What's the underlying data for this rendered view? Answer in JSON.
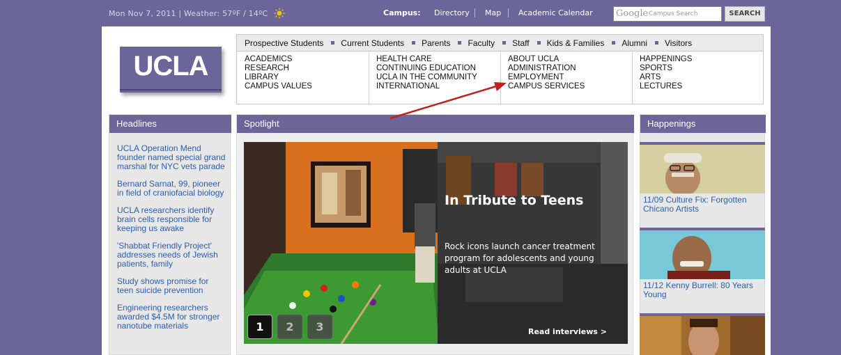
{
  "topbar": {
    "date_weather": "Mon Nov 7, 2011 | Weather: 57ºF / 14ºC",
    "campus_label": "Campus:",
    "links": [
      "Directory",
      "Map",
      "Academic Calendar"
    ],
    "search_logo": "Google",
    "search_placeholder": "Campus Search",
    "search_button": "SEARCH"
  },
  "logo": {
    "text": "UCLA"
  },
  "audience": [
    "Prospective Students",
    "Current Students",
    "Parents",
    "Faculty",
    "Staff",
    "Kids & Families",
    "Alumni",
    "Visitors"
  ],
  "mega_menu": [
    [
      "ACADEMICS",
      "RESEARCH",
      "LIBRARY",
      "CAMPUS VALUES"
    ],
    [
      "HEALTH CARE",
      "CONTINUING EDUCATION",
      "UCLA IN THE COMMUNITY",
      "INTERNATIONAL"
    ],
    [
      "ABOUT UCLA",
      "ADMINISTRATION",
      "EMPLOYMENT",
      "CAMPUS SERVICES"
    ],
    [
      "HAPPENINGS",
      "SPORTS",
      "ARTS",
      "LECTURES"
    ]
  ],
  "headlines": {
    "title": "Headlines",
    "items": [
      "UCLA Operation Mend founder named special grand marshal for NYC vets parade",
      "Bernard Sarnat, 99, pioneer in field of craniofacial biology",
      "UCLA researchers identify brain cells responsible for keeping us awake",
      "'Shabbat Friendly Project' addresses needs of Jewish patients, family",
      "Study shows promise for teen suicide prevention",
      "Engineering researchers awarded $4.5M for stronger nanotube materials"
    ]
  },
  "spotlight": {
    "title": "Spotlight",
    "slide_title": "In Tribute to Teens",
    "slide_description": "Rock icons launch cancer treatment program for adolescents and young adults at UCLA",
    "read_more": "Read interviews  >",
    "pager": [
      "1",
      "2",
      "3"
    ],
    "active_page": "1"
  },
  "happenings": {
    "title": "Happenings",
    "items": [
      "11/09 Culture Fix: Forgotten Chicano Artists",
      "11/12 Kenny Burrell: 80 Years Young"
    ]
  },
  "colors": {
    "brand_purple": "#6b6599",
    "link_blue": "#2a5db0",
    "annotation_arrow": "#c0201e"
  }
}
